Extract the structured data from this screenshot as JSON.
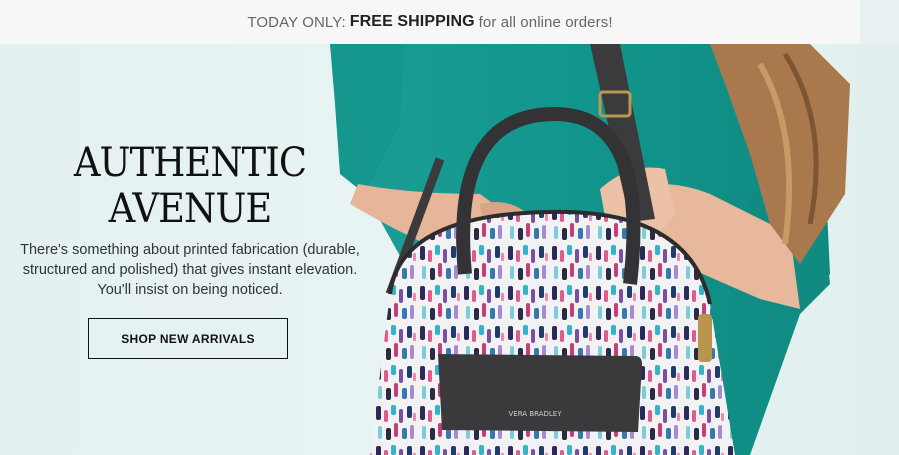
{
  "promo": {
    "prefix": "TODAY ONLY:",
    "highlight": "FREE SHIPPING",
    "suffix": "for all online orders!"
  },
  "hero": {
    "title_line1": "AUTHENTIC",
    "title_line2": "AVENUE",
    "body": "There's something about printed fabrication (durable, structured and polished) that gives instant elevation. You'll insist on being noticed.",
    "cta_label": "SHOP NEW ARRIVALS",
    "bag_brand": "VERA BRADLEY"
  },
  "colors": {
    "background": "#e6f2f2",
    "shirt": "#1aa39a",
    "bag_leather": "#3a3a3c"
  }
}
